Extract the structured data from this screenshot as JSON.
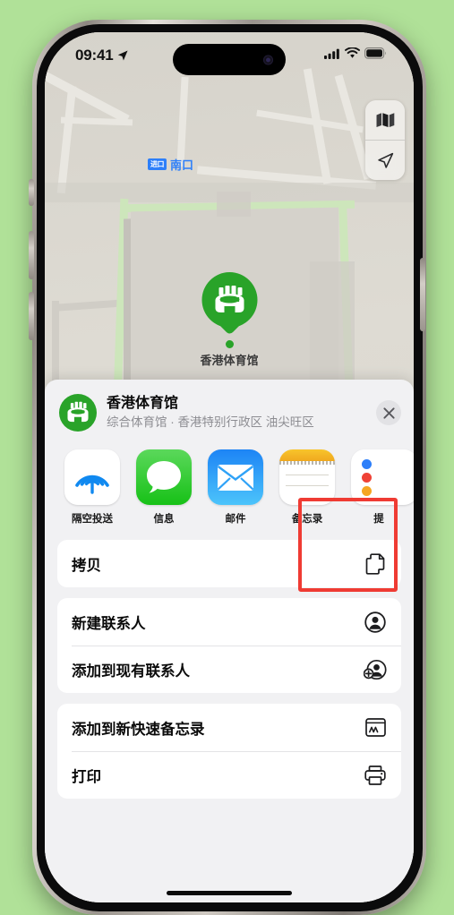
{
  "status_bar": {
    "time": "09:41",
    "location_arrow": "location-arrow-icon",
    "cellular": "signal-bars-icon",
    "wifi": "wifi-icon",
    "battery": "battery-icon"
  },
  "map": {
    "poi_label": "香港体育馆",
    "entrance_badge": "进口",
    "entrance_label": "南口",
    "controls": [
      {
        "name": "map-layers-button",
        "icon": "map-icon"
      },
      {
        "name": "locate-me-button",
        "icon": "location-arrow-icon"
      }
    ],
    "pin_color": "#29a329"
  },
  "share_sheet": {
    "title": "香港体育馆",
    "subtitle": "综合体育馆 · 香港特别行政区 油尖旺区",
    "close_label": "×",
    "apps": [
      {
        "label": "隔空投送",
        "icon": "airdrop-icon",
        "highlighted": false
      },
      {
        "label": "信息",
        "icon": "messages-icon",
        "highlighted": false
      },
      {
        "label": "邮件",
        "icon": "mail-icon",
        "highlighted": false
      },
      {
        "label": "备忘录",
        "icon": "notes-icon",
        "highlighted": true
      },
      {
        "label": "提",
        "icon": "reminders-icon",
        "highlighted": false
      }
    ],
    "action_groups": [
      {
        "rows": [
          {
            "label": "拷贝",
            "icon": "copy-icon"
          }
        ]
      },
      {
        "rows": [
          {
            "label": "新建联系人",
            "icon": "person-circle-icon"
          },
          {
            "label": "添加到现有联系人",
            "icon": "person-add-icon"
          }
        ]
      },
      {
        "rows": [
          {
            "label": "添加到新快速备忘录",
            "icon": "quick-note-icon"
          },
          {
            "label": "打印",
            "icon": "printer-icon"
          }
        ]
      }
    ]
  },
  "annotation": {
    "highlight_color": "#ef3b33",
    "target": "备忘录"
  },
  "colors": {
    "background": "#b0e198",
    "sheet_background": "#f1f1f3",
    "accent_green": "#29a329",
    "accent_blue": "#2d7ff9"
  }
}
